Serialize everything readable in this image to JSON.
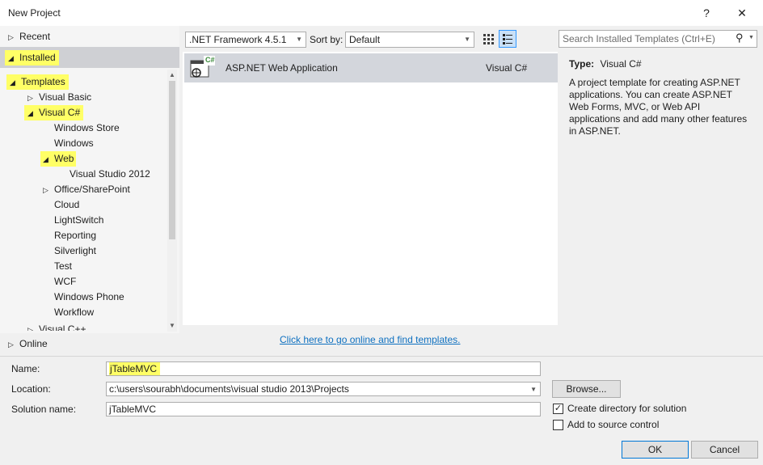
{
  "window": {
    "title": "New Project",
    "help_glyph": "?",
    "close_glyph": "✕"
  },
  "tree": {
    "recent": "Recent",
    "installed": "Installed",
    "templates": "Templates",
    "visual_basic": "Visual Basic",
    "visual_csharp": "Visual C#",
    "children": [
      "Windows Store",
      "Windows"
    ],
    "web": "Web",
    "web_children": [
      "Visual Studio 2012"
    ],
    "office": "Office/SharePoint",
    "more_children": [
      "Cloud",
      "LightSwitch",
      "Reporting",
      "Silverlight",
      "Test",
      "WCF",
      "Windows Phone",
      "Workflow"
    ],
    "truncated": "Visual C++",
    "online": "Online"
  },
  "toolbar": {
    "framework": ".NET Framework 4.5.1",
    "sort_label": "Sort by:",
    "sort_value": "Default"
  },
  "templates_list": [
    {
      "name": "ASP.NET Web Application",
      "language": "Visual C#",
      "badge": "C#"
    }
  ],
  "online_link": "Click here to go online and find templates.",
  "search": {
    "placeholder": "Search Installed Templates (Ctrl+E)"
  },
  "description": {
    "type_label": "Type:",
    "type_value": "Visual C#",
    "text": "A project template for creating ASP.NET applications. You can create ASP.NET Web Forms, MVC,  or Web API applications and add many other features in ASP.NET."
  },
  "form": {
    "name_label": "Name:",
    "name_value": "jTableMVC",
    "location_label": "Location:",
    "location_value": "c:\\users\\sourabh\\documents\\visual studio 2013\\Projects",
    "solution_label": "Solution name:",
    "solution_value": "jTableMVC",
    "browse": "Browse...",
    "create_dir": "Create directory for solution",
    "create_dir_checked": true,
    "source_control": "Add to source control",
    "source_control_checked": false,
    "ok": "OK",
    "cancel": "Cancel"
  },
  "colors": {
    "highlight": "#ffff66",
    "link": "#0e70c0",
    "selected_row": "#d3d6dc"
  }
}
